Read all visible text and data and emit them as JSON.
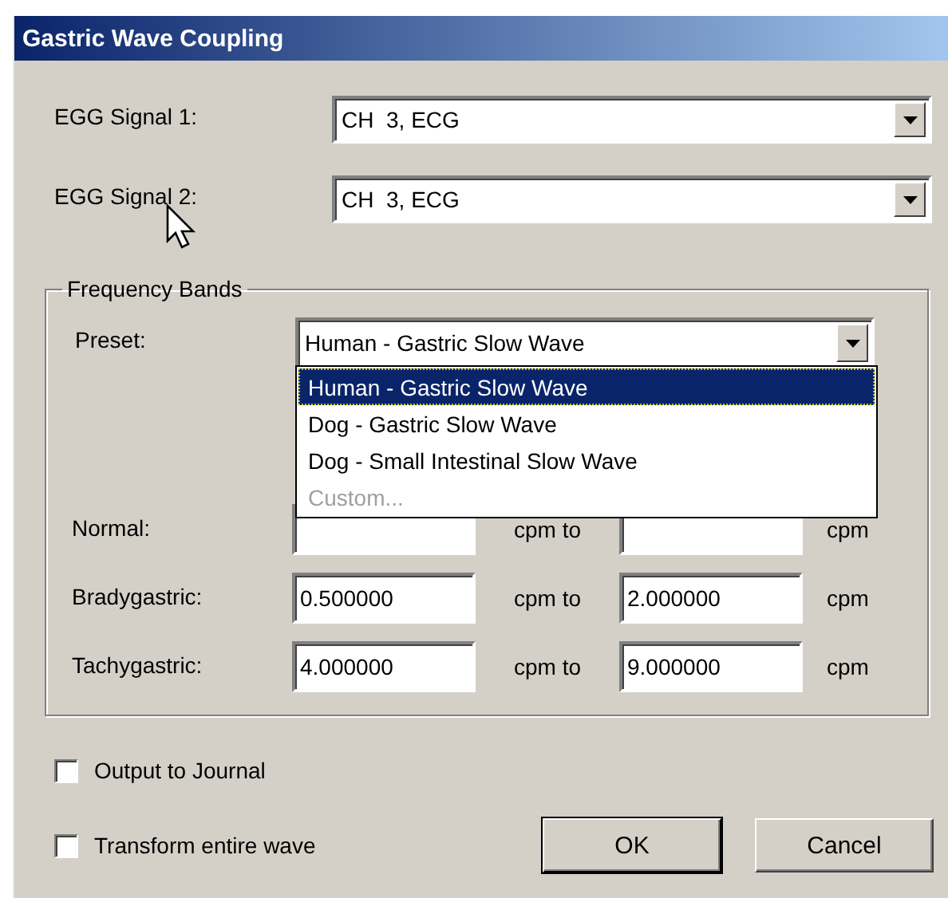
{
  "window": {
    "title": "Gastric Wave Coupling"
  },
  "signals": [
    {
      "label": "EGG Signal 1:",
      "value": "CH  3, ECG"
    },
    {
      "label": "EGG Signal 2:",
      "value": "CH  3, ECG"
    }
  ],
  "frequency_bands": {
    "title": "Frequency Bands",
    "preset": {
      "label": "Preset:",
      "value": "Human - Gastric Slow Wave",
      "expanded": true,
      "options": [
        {
          "label": "Human - Gastric Slow Wave",
          "selected": true,
          "disabled": false
        },
        {
          "label": "Dog - Gastric Slow Wave",
          "selected": false,
          "disabled": false
        },
        {
          "label": "Dog - Small Intestinal Slow Wave",
          "selected": false,
          "disabled": false
        },
        {
          "label": "Custom...",
          "selected": false,
          "disabled": true
        }
      ]
    },
    "bands": [
      {
        "label": "Normal:",
        "separator": "cpm to",
        "unit": "cpm"
      },
      {
        "label": "Bradygastric:",
        "low": "0.500000",
        "separator": "cpm to",
        "high": "2.000000",
        "unit": "cpm"
      },
      {
        "label": "Tachygastric:",
        "low": "4.000000",
        "separator": "cpm to",
        "high": "9.000000",
        "unit": "cpm"
      }
    ]
  },
  "checkboxes": [
    {
      "label": "Output to Journal",
      "checked": false
    },
    {
      "label": "Transform entire wave",
      "checked": false
    }
  ],
  "buttons": [
    {
      "label": "OK",
      "default": true
    },
    {
      "label": "Cancel",
      "default": false
    }
  ]
}
